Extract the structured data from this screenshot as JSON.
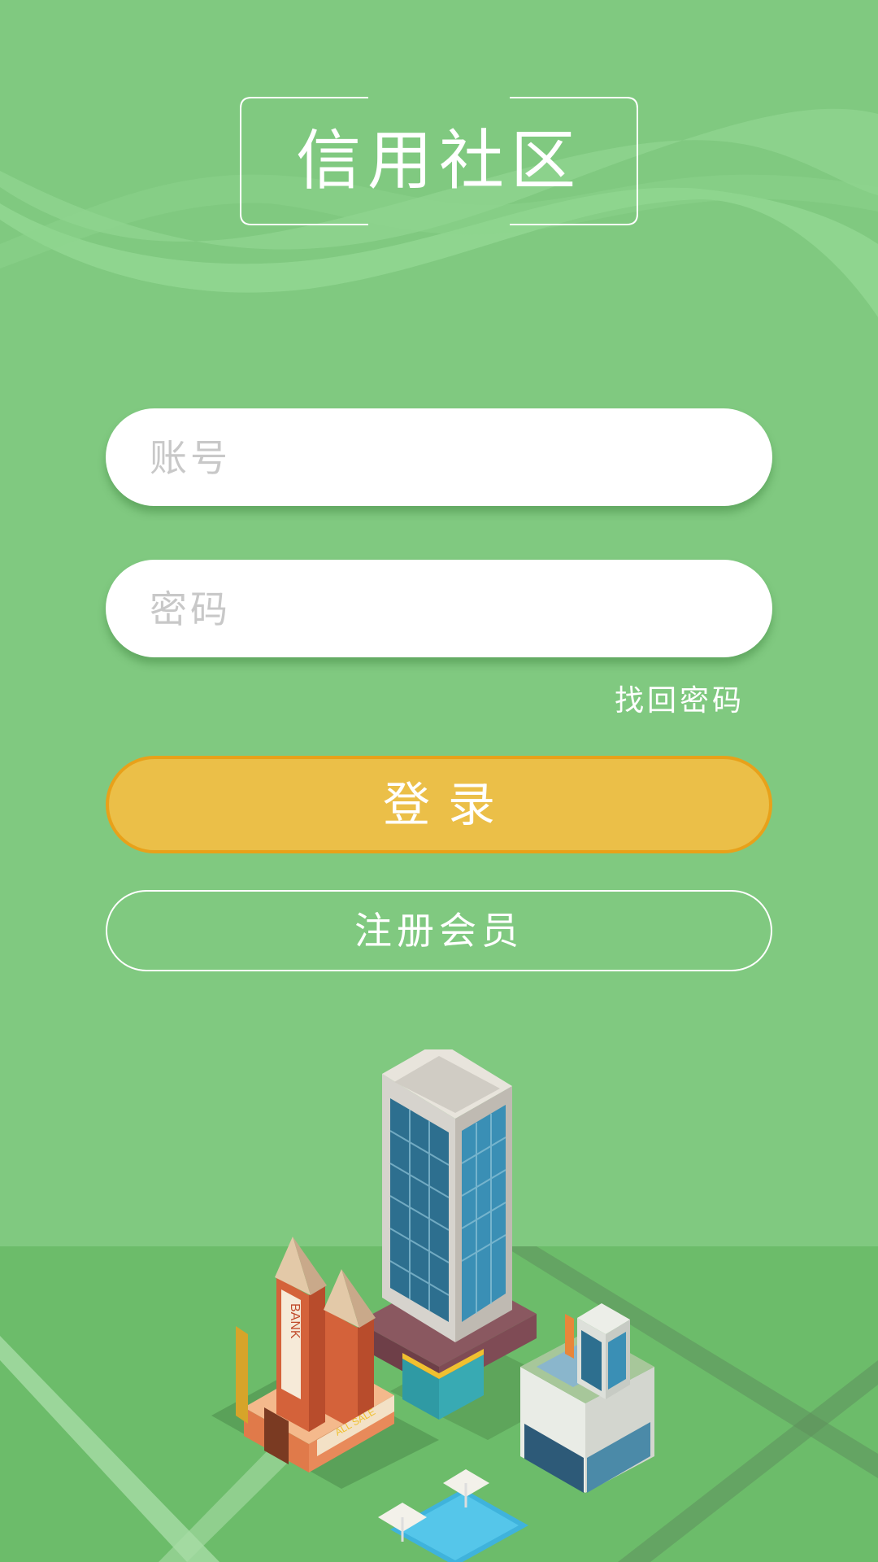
{
  "app": {
    "title": "信用社区"
  },
  "login_form": {
    "account_placeholder": "账号",
    "password_placeholder": "密码",
    "forgot_password_label": "找回密码",
    "login_label": "登录",
    "register_label": "注册会员"
  },
  "illustration": {
    "bank_sign": "BANK",
    "sale_sign": "ALL SALE"
  },
  "colors": {
    "background": "#80c980",
    "ground": "#6cbc6a",
    "login_button": "#ebbf48",
    "login_button_border": "#e8a11a"
  }
}
